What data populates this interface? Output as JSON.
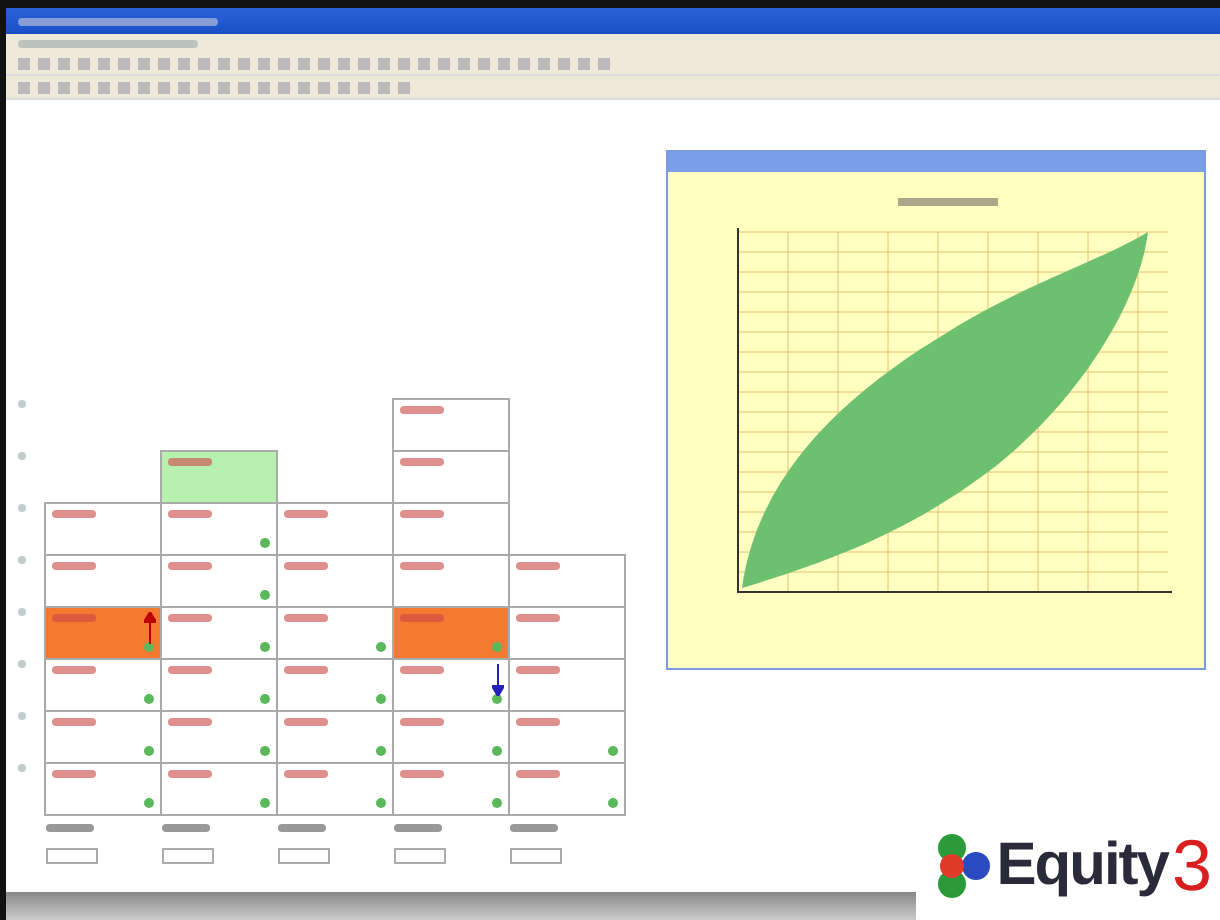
{
  "grid": {
    "rows": [
      [
        {
          "kind": "empty"
        },
        {
          "kind": "empty"
        },
        {
          "kind": "empty"
        },
        {
          "kind": "plain",
          "color": "#ffffff",
          "dot": false
        },
        {
          "kind": "empty"
        }
      ],
      [
        {
          "kind": "empty"
        },
        {
          "kind": "plain",
          "color": "#b8f0b0",
          "dot": false
        },
        {
          "kind": "empty"
        },
        {
          "kind": "plain",
          "color": "#ffffff",
          "dot": false
        },
        {
          "kind": "empty"
        }
      ],
      [
        {
          "kind": "plain",
          "color": "#ffffff",
          "dot": false
        },
        {
          "kind": "plain",
          "color": "#ffffff",
          "dot": true
        },
        {
          "kind": "plain",
          "color": "#ffffff",
          "dot": false
        },
        {
          "kind": "plain",
          "color": "#ffffff",
          "dot": false
        },
        {
          "kind": "empty"
        }
      ],
      [
        {
          "kind": "plain",
          "color": "#ffffff",
          "dot": false
        },
        {
          "kind": "plain",
          "color": "#ffffff",
          "dot": true
        },
        {
          "kind": "plain",
          "color": "#ffffff",
          "dot": false
        },
        {
          "kind": "plain",
          "color": "#ffffff",
          "dot": false
        },
        {
          "kind": "plain",
          "color": "#ffffff",
          "dot": false
        }
      ],
      [
        {
          "kind": "up",
          "color": "#f47a32",
          "dot": true
        },
        {
          "kind": "plain",
          "color": "#ffffff",
          "dot": true
        },
        {
          "kind": "plain",
          "color": "#ffffff",
          "dot": true
        },
        {
          "kind": "plain",
          "color": "#f47a32",
          "dot": true
        },
        {
          "kind": "plain",
          "color": "#ffffff",
          "dot": false
        }
      ],
      [
        {
          "kind": "plain",
          "color": "#ffffff",
          "dot": true
        },
        {
          "kind": "plain",
          "color": "#ffffff",
          "dot": true
        },
        {
          "kind": "plain",
          "color": "#ffffff",
          "dot": true
        },
        {
          "kind": "down",
          "color": "#ffffff",
          "dot": true
        },
        {
          "kind": "plain",
          "color": "#ffffff",
          "dot": false
        }
      ],
      [
        {
          "kind": "plain",
          "color": "#ffffff",
          "dot": true
        },
        {
          "kind": "plain",
          "color": "#ffffff",
          "dot": true
        },
        {
          "kind": "plain",
          "color": "#ffffff",
          "dot": true
        },
        {
          "kind": "plain",
          "color": "#ffffff",
          "dot": true
        },
        {
          "kind": "plain",
          "color": "#ffffff",
          "dot": true
        }
      ],
      [
        {
          "kind": "plain",
          "color": "#ffffff",
          "dot": true
        },
        {
          "kind": "plain",
          "color": "#ffffff",
          "dot": true
        },
        {
          "kind": "plain",
          "color": "#ffffff",
          "dot": true
        },
        {
          "kind": "plain",
          "color": "#ffffff",
          "dot": true
        },
        {
          "kind": "plain",
          "color": "#ffffff",
          "dot": true
        }
      ]
    ]
  },
  "logo": {
    "word": "Equity",
    "digit": "3"
  }
}
